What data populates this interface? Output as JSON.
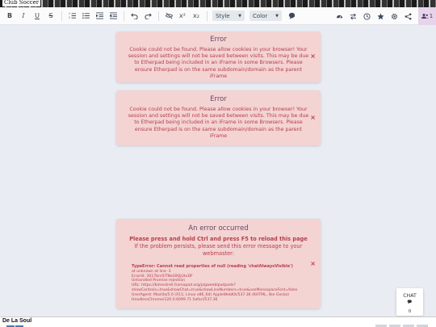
{
  "window": {
    "tab_title": "Club Soccer"
  },
  "toolbar": {
    "bold": "B",
    "italic": "I",
    "underline": "U",
    "strike": "S",
    "superscript": "x²",
    "subscript": "x₂",
    "style_select": "Style",
    "color_select": "Color",
    "users_count": "1"
  },
  "cookie_error_1": {
    "title": "Error",
    "message": "Cookie could not be found. Please allow cookies in your browser! Your session and settings will not be saved between visits. This may be due to Etherpad being included in an iFrame in some Browsers. Please ensure Etherpad is on the same subdomain/domain as the parent iFrame",
    "close": "×"
  },
  "cookie_error_2": {
    "title": "Error",
    "message": "Cookie could not be found. Please allow cookies in your browser! Your session and settings will not be saved between visits. This may be due to Etherpad being included in an iFrame in some Browsers. Please ensure Etherpad is on the same subdomain/domain as the parent iFrame",
    "close": "×"
  },
  "app_error": {
    "title": "An error occurred",
    "instruction": "Please press and hold Ctrl and press F5 to reload this page",
    "instruction2": "If the problem persists, please send this error message to your webmaster:",
    "close": "×",
    "trace": [
      "TypeError: Cannot read properties of null (reading 'chatAlwaysVisible')",
      "at unknown at line -1",
      "ErrorId: 3017bm5lTNeS9QjUtxDF",
      "Unhandled Promise rejection",
      "URL: https://bimestrell.framapad.org/p/gweeblpodpads?showControls=true&showChat=true&showLineNumbers=true&useMonospaceFont=false",
      "UserAgent: Mozilla/5.0 (X11; Linux x86_64) AppleWebKit/537.36 (KHTML, like Gecko) HeadlessChrome/120.0.6099.71 Safari/537.36"
    ]
  },
  "chat": {
    "label": "CHAT",
    "count": "0"
  },
  "footer": {
    "label": "De La Soul"
  }
}
